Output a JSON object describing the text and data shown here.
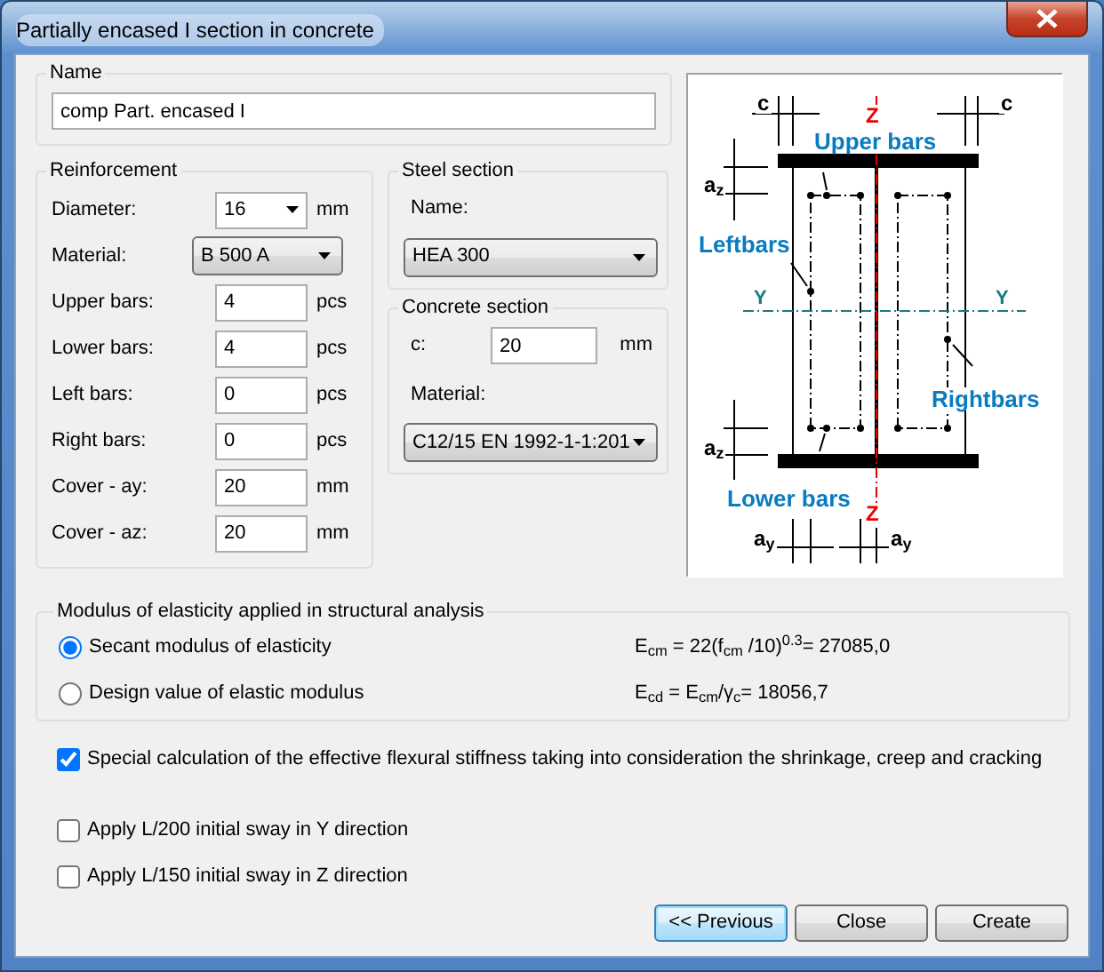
{
  "window": {
    "title": "Partially encased I section in concrete"
  },
  "name_group": {
    "legend": "Name",
    "value": "comp Part. encased I"
  },
  "reinforcement": {
    "legend": "Reinforcement",
    "rows": [
      {
        "kind": "combo",
        "label": "Diameter:",
        "value": "16",
        "unit": "mm"
      },
      {
        "kind": "dropdown",
        "label": "Material:",
        "value": "B 500 A"
      },
      {
        "kind": "input",
        "label": "Upper bars:",
        "value": "4",
        "unit": "pcs"
      },
      {
        "kind": "input",
        "label": "Lower bars:",
        "value": "4",
        "unit": "pcs"
      },
      {
        "kind": "input",
        "label": "Left bars:",
        "value": "0",
        "unit": "pcs"
      },
      {
        "kind": "input",
        "label": "Right bars:",
        "value": "0",
        "unit": "pcs"
      },
      {
        "kind": "input",
        "label": "Cover - ay:",
        "value": "20",
        "unit": "mm"
      },
      {
        "kind": "input",
        "label": "Cover - az:",
        "value": "20",
        "unit": "mm"
      }
    ]
  },
  "steel_section": {
    "legend": "Steel section",
    "name_label": "Name:",
    "value": "HEA 300"
  },
  "concrete_section": {
    "legend": "Concrete section",
    "c_label": "c:",
    "c_value": "20",
    "c_unit": "mm",
    "material_label": "Material:",
    "material": "C12/15 EN 1992-1-1:201"
  },
  "diagram": {
    "labels": [
      {
        "kind": "dim",
        "text": "c"
      },
      {
        "kind": "axis_z",
        "text": "Z"
      },
      {
        "kind": "dim",
        "text": "c"
      },
      {
        "kind": "bars",
        "text": "Upper bars"
      },
      {
        "kind": "dim",
        "text": "a$_{z}$"
      },
      {
        "kind": "bars",
        "text": "Leftbars"
      },
      {
        "kind": "axis_y",
        "text": "Y"
      },
      {
        "kind": "axis_y",
        "text": "Y"
      },
      {
        "kind": "bars",
        "text": "Rightbars"
      },
      {
        "kind": "dim",
        "text": "a$_{z}$"
      },
      {
        "kind": "bars",
        "text": "Lower bars"
      },
      {
        "kind": "axis_z",
        "text": "Z"
      },
      {
        "kind": "dim",
        "text": "a$_{y}$"
      },
      {
        "kind": "dim",
        "text": "a$_{y}$"
      }
    ]
  },
  "modulus": {
    "legend": "Modulus of elasticity applied in structural analysis",
    "options": [
      {
        "label": "Secant modulus of elasticity",
        "formula": "E$_{cm}$ = 22(f$_{cm}$ /10)$^{0.3}$= 27085,0",
        "selected": true
      },
      {
        "label": "Design value of elastic modulus",
        "formula": "E$_{cd}$ = E$_{cm}$/γ$_{c}$= 18056,7",
        "selected": false
      }
    ]
  },
  "checkboxes": [
    {
      "label": "Special calculation of the effective flexural stiffness taking into consideration the shrinkage, creep and cracking",
      "checked": true
    },
    {
      "label": "Apply L/200 initial sway in Y direction",
      "checked": false
    },
    {
      "label": "Apply L/150 initial sway in Z direction",
      "checked": false
    }
  ],
  "buttons": [
    {
      "label": "<< Previous",
      "default": true
    },
    {
      "label": "Close",
      "default": false
    },
    {
      "label": "Create",
      "default": false
    }
  ]
}
